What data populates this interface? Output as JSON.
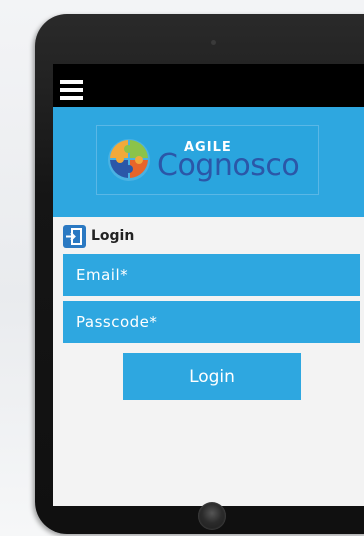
{
  "app": {
    "logo": {
      "prefix": "AGILE",
      "name": "Cognosco"
    }
  },
  "nav": {
    "menu_icon": "hamburger-menu-icon"
  },
  "login": {
    "heading": "Login",
    "heading_icon": "login-door-icon",
    "email_placeholder": "Email*",
    "email_value": "",
    "passcode_placeholder": "Passcode*",
    "passcode_value": "",
    "button_label": "Login"
  },
  "colors": {
    "accent": "#2ea7e0",
    "logo_text": "#2b57a8",
    "topbar": "#000000",
    "icon_blue": "#2b79c2"
  }
}
